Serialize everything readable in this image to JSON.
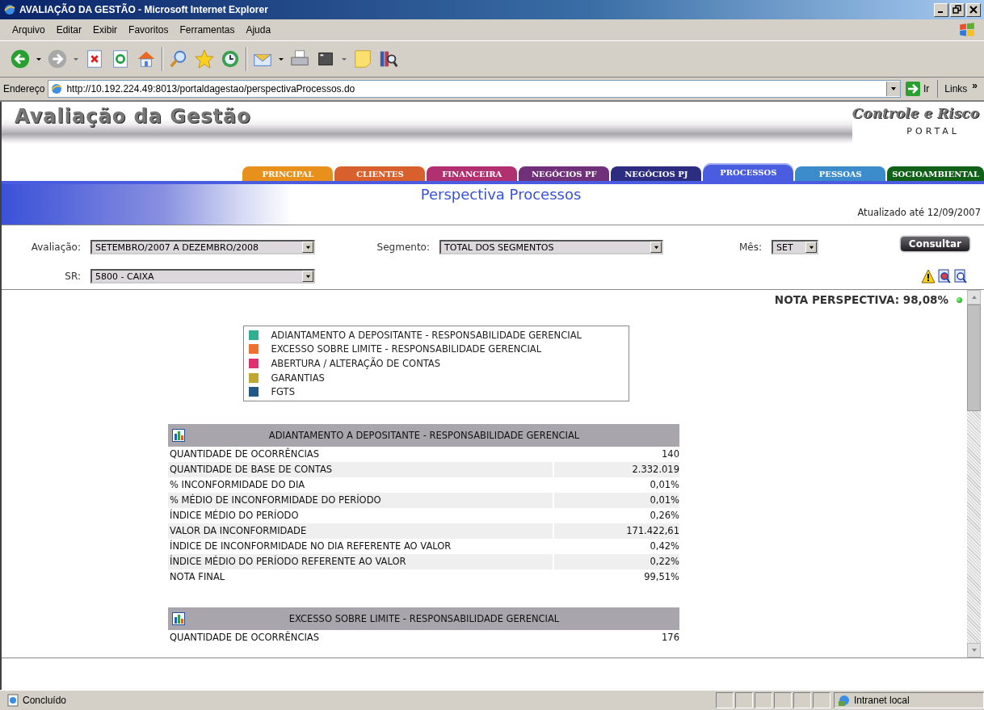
{
  "window": {
    "title": "AVALIAÇÃO DA GESTÃO - Microsoft Internet Explorer"
  },
  "menu": [
    "Arquivo",
    "Editar",
    "Exibir",
    "Favoritos",
    "Ferramentas",
    "Ajuda"
  ],
  "address_bar": {
    "label": "Endereço",
    "value": "http://10.192.224.49:8013/portaldagestao/perspectivaProcessos.do",
    "go": "Ir",
    "links": "Links",
    "more": "»"
  },
  "banner": {
    "title": "Avaliação da Gestão",
    "brand": "Controle e Risco",
    "subtitle": "PORTAL"
  },
  "tabs": [
    {
      "label": "PRINCIPAL",
      "color": "#e8901c",
      "selected": false
    },
    {
      "label": "CLIENTES",
      "color": "#d8602c",
      "selected": false
    },
    {
      "label": "FINANCEIRA",
      "color": "#b03070",
      "selected": false
    },
    {
      "label": "NEGÓCIOS PF",
      "color": "#70307a",
      "selected": false
    },
    {
      "label": "NEGÓCIOS PJ",
      "color": "#2c2c80",
      "selected": false
    },
    {
      "label": "PROCESSOS",
      "color": "#4a5ce0",
      "selected": true
    },
    {
      "label": "PESSOAS",
      "color": "#3c8ccc",
      "selected": false
    },
    {
      "label": "SOCIOAMBIENTAL",
      "color": "#106018",
      "selected": false
    }
  ],
  "page_title": "Perspectiva Processos",
  "updated": "Atualizado até 12/09/2007",
  "filters": {
    "avaliacao": {
      "label": "Avaliação:",
      "value": "SETEMBRO/2007 A DEZEMBRO/2008"
    },
    "segmento": {
      "label": "Segmento:",
      "value": "TOTAL DOS SEGMENTOS"
    },
    "mes": {
      "label": "Mês:",
      "value": "SET"
    },
    "sr": {
      "label": "SR:",
      "value": "5800 - CAIXA"
    },
    "button": "Consultar"
  },
  "nota": "NOTA PERSPECTIVA: 98,08%",
  "legend": [
    {
      "label": "ADIANTAMENTO A DEPOSITANTE - RESPONSABILIDADE GERENCIAL",
      "color": "#30b090"
    },
    {
      "label": "EXCESSO SOBRE LIMITE - RESPONSABILIDADE GERENCIAL",
      "color": "#f07030"
    },
    {
      "label": "ABERTURA / ALTERAÇÃO DE CONTAS",
      "color": "#e03070"
    },
    {
      "label": "GARANTIAS",
      "color": "#c0a830"
    },
    {
      "label": "FGTS",
      "color": "#205888"
    }
  ],
  "sections": [
    {
      "title": "ADIANTAMENTO A DEPOSITANTE - RESPONSABILIDADE GERENCIAL",
      "rows": [
        {
          "label": "QUANTIDADE DE OCORRÊNCIAS",
          "value": "140"
        },
        {
          "label": "QUANTIDADE DE BASE DE CONTAS",
          "value": "2.332.019"
        },
        {
          "label": "% INCONFORMIDADE DO DIA",
          "value": "0,01%"
        },
        {
          "label": "% MÉDIO DE INCONFORMIDADE DO PERÍODO",
          "value": "0,01%"
        },
        {
          "label": "ÍNDICE MÉDIO DO PERÍODO",
          "value": "0,26%"
        },
        {
          "label": "VALOR DA INCONFORMIDADE",
          "value": "171.422,61"
        },
        {
          "label": "ÍNDICE DE INCONFORMIDADE NO DIA REFERENTE AO VALOR",
          "value": "0,42%"
        },
        {
          "label": "ÍNDICE MÉDIO DO PERÍODO REFERENTE AO VALOR",
          "value": "0,22%"
        },
        {
          "label": "NOTA FINAL",
          "value": "99,51%"
        }
      ]
    },
    {
      "title": "EXCESSO SOBRE LIMITE - RESPONSABILIDADE GERENCIAL",
      "rows": [
        {
          "label": "QUANTIDADE DE OCORRÊNCIAS",
          "value": "176"
        }
      ]
    }
  ],
  "status_bar": {
    "text": "Concluído",
    "zone": "Intranet local"
  }
}
